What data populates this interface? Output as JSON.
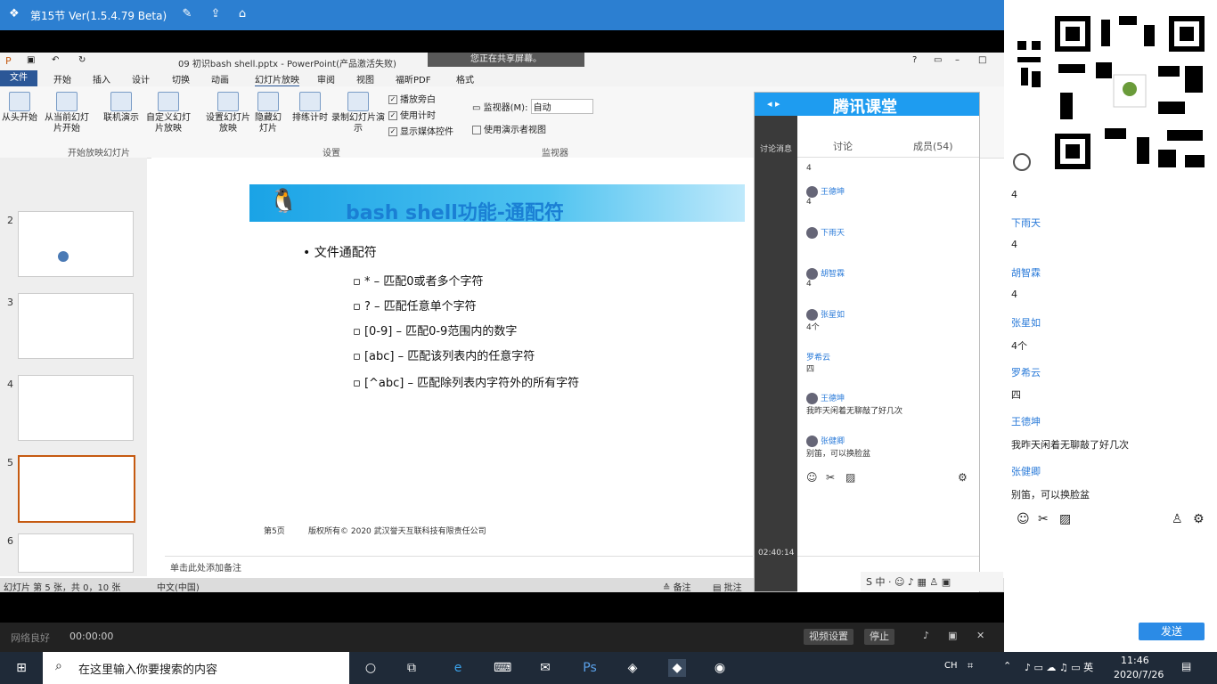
{
  "topbar": {
    "title": "第15节 Ver(1.5.4.79 Beta)"
  },
  "ppt": {
    "window_title": "09 初识bash shell.pptx - PowerPoint(产品激活失败)",
    "share_tip": "您正在共享屏幕。",
    "tabs": [
      "文件",
      "开始",
      "插入",
      "设计",
      "切换",
      "动画",
      "幻灯片放映",
      "审阅",
      "视图",
      "福昕PDF",
      "格式"
    ],
    "ribbon": {
      "from_start": "从头开始",
      "from_current": "从当前幻灯片开始",
      "online_present": "联机演示",
      "custom_show": "自定义幻灯片放映",
      "setup_show": "设置幻灯片放映",
      "hide_slide": "隐藏幻灯片",
      "rehearse": "排练计时",
      "record": "录制幻灯片演示",
      "group_start": "开始放映幻灯片",
      "group_setup": "设置",
      "group_monitor": "监视器",
      "check_narration": "播放旁白",
      "check_timing": "使用计时",
      "check_media": "显示媒体控件",
      "monitor_label": "监视器(M):",
      "monitor_value": "自动",
      "presenter_view": "使用演示者视图"
    },
    "thumb_numbers": [
      "2",
      "3",
      "4",
      "5",
      "6"
    ],
    "slide": {
      "title": "bash shell功能-通配符",
      "main_bullet": "文件通配符",
      "sub_bullets": [
        "* – 匹配0或者多个字符",
        "? – 匹配任意单个字符",
        "[0-9] – 匹配0-9范围内的数字",
        "[abc] – 匹配该列表内的任意字符",
        "[^abc] – 匹配除列表内字符外的所有字符"
      ],
      "page_no": "第5页",
      "copyright": "版权所有© 2020 武汉誉天互联科技有限责任公司"
    },
    "notes_placeholder": "单击此处添加备注",
    "status": {
      "slide_info": "幻灯片 第 5 张，共 0，10 张",
      "language": "中文(中国)",
      "notes_btn": "备注",
      "comments_btn": "批注"
    }
  },
  "tencent": {
    "logo": "腾讯课堂",
    "tab_discuss": "讨论",
    "tab_members": "成员(54)",
    "left_label": "讨论消息",
    "timer": "02:40:14",
    "messages": [
      {
        "name": "",
        "text": "4"
      },
      {
        "name": "王德坤",
        "text": "4"
      },
      {
        "name": "下雨天",
        "text": ""
      },
      {
        "name": "",
        "text": "4"
      },
      {
        "name": "胡智霖",
        "text": "4"
      },
      {
        "name": "张星如",
        "text": "4个"
      },
      {
        "name": "罗希云",
        "text": "四"
      },
      {
        "name": "王德坤",
        "text": "我昨天闲着无聊敲了好几次"
      },
      {
        "name": "张健卿",
        "text": "别笛，可以换脸盆"
      }
    ]
  },
  "rchat": {
    "messages": [
      {
        "name": "",
        "text": "4"
      },
      {
        "name": "下雨天",
        "text": "4"
      },
      {
        "name": "胡智霖",
        "text": "4"
      },
      {
        "name": "张星如",
        "text": "4个"
      },
      {
        "name": "罗希云",
        "text": "四"
      },
      {
        "name": "王德坤",
        "text": "我昨天闲着无聊敲了好几次"
      },
      {
        "name": "张健卿",
        "text": "别笛，可以换脸盆"
      }
    ],
    "send_label": "发送"
  },
  "bottombar": {
    "status": "网络良好",
    "time": "00:00:00",
    "btn_settings": "视频设置",
    "btn_close": "停止"
  },
  "taskbar": {
    "search_placeholder": "在这里输入你要搜索的内容",
    "ime": "CH",
    "time": "11:46",
    "date": "2020/7/26"
  }
}
